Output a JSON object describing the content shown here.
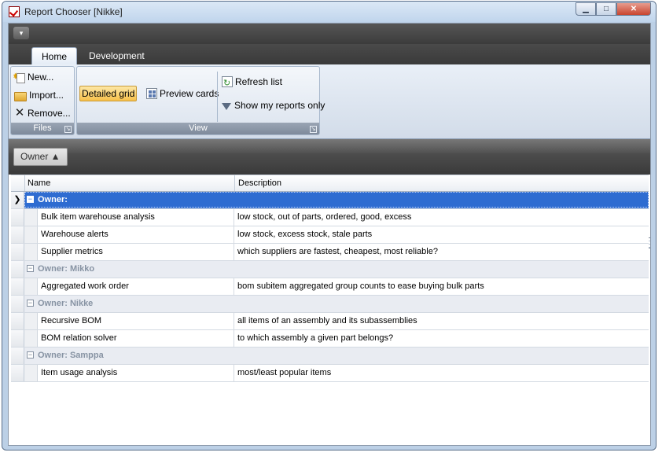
{
  "window": {
    "title": "Report Chooser [Nikke]",
    "min_glyph": "▁",
    "max_glyph": "□",
    "close_glyph": "✕"
  },
  "qat": {
    "menu_glyph": "▾"
  },
  "tabs": [
    {
      "label": "Home",
      "active": true
    },
    {
      "label": "Development",
      "active": false
    }
  ],
  "ribbon": {
    "files": {
      "label": "Files",
      "new": "New...",
      "import": "Import...",
      "remove": "Remove..."
    },
    "view": {
      "label": "View",
      "detailed_grid": "Detailed grid",
      "preview_cards": "Preview cards",
      "refresh_list": "Refresh list",
      "show_my_reports_only": "Show my reports only"
    }
  },
  "groupbar": {
    "chip": "Owner ▲"
  },
  "grid": {
    "columns": {
      "name": "Name",
      "description": "Description"
    },
    "selected_indicator": "❯",
    "groups": [
      {
        "label": "Owner:",
        "selected": true,
        "rows": [
          {
            "name": "Bulk item warehouse analysis",
            "description": "low stock, out of parts, ordered, good, excess"
          },
          {
            "name": "Warehouse alerts",
            "description": "low stock, excess stock, stale parts"
          },
          {
            "name": "Supplier metrics",
            "description": "which suppliers are fastest, cheapest, most reliable?"
          }
        ]
      },
      {
        "label": "Owner: Mikko",
        "selected": false,
        "rows": [
          {
            "name": "Aggregated work order",
            "description": "bom subitem aggregated group counts to ease buying bulk parts"
          }
        ]
      },
      {
        "label": "Owner: Nikke",
        "selected": false,
        "rows": [
          {
            "name": "Recursive BOM",
            "description": "all items of an assembly and its subassemblies"
          },
          {
            "name": "BOM relation solver",
            "description": "to which assembly a given part belongs?"
          }
        ]
      },
      {
        "label": "Owner: Samppa",
        "selected": false,
        "rows": [
          {
            "name": "Item usage analysis",
            "description": "most/least popular items"
          }
        ]
      }
    ]
  }
}
